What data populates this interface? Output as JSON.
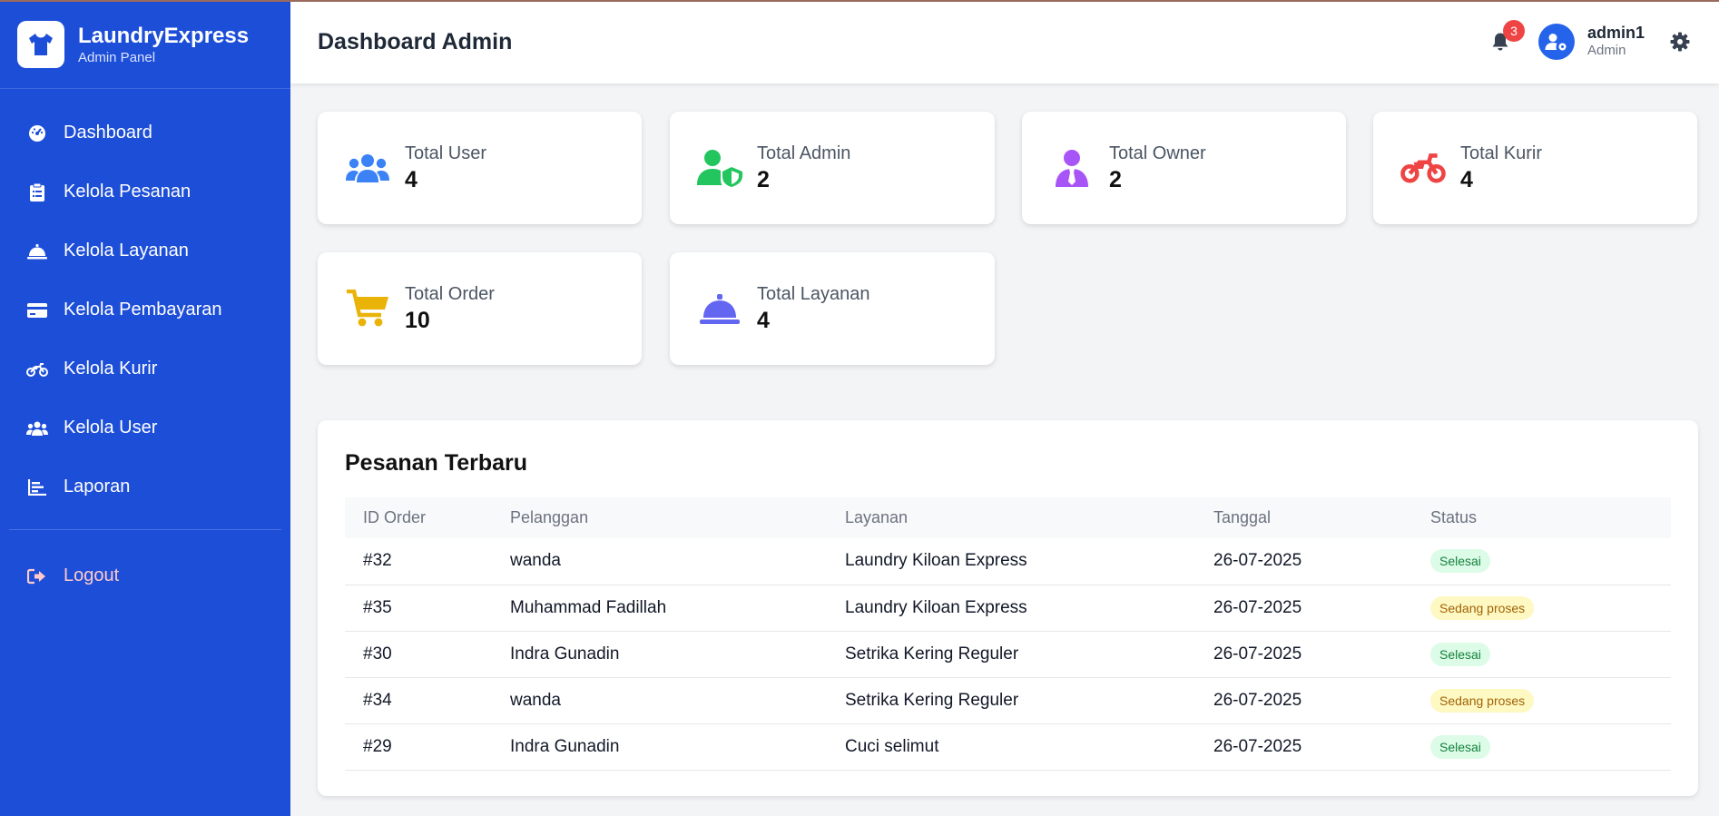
{
  "brand": {
    "name": "LaundryExpress",
    "subtitle": "Admin Panel"
  },
  "sidebar": {
    "items": [
      {
        "label": "Dashboard",
        "icon": "gauge-icon"
      },
      {
        "label": "Kelola Pesanan",
        "icon": "clipboard-icon"
      },
      {
        "label": "Kelola Layanan",
        "icon": "service-bell-icon"
      },
      {
        "label": "Kelola Pembayaran",
        "icon": "credit-card-icon"
      },
      {
        "label": "Kelola Kurir",
        "icon": "motorcycle-icon"
      },
      {
        "label": "Kelola User",
        "icon": "users-icon"
      },
      {
        "label": "Laporan",
        "icon": "chart-icon"
      }
    ],
    "logout": {
      "label": "Logout",
      "icon": "logout-icon"
    }
  },
  "header": {
    "title": "Dashboard Admin",
    "notification_count": "3",
    "user": {
      "name": "admin1",
      "role": "Admin"
    }
  },
  "stats": [
    {
      "label": "Total User",
      "value": "4",
      "icon": "users-icon",
      "color": "#3b82f6"
    },
    {
      "label": "Total Admin",
      "value": "2",
      "icon": "user-shield-icon",
      "color": "#22c55e"
    },
    {
      "label": "Total Owner",
      "value": "2",
      "icon": "user-tie-icon",
      "color": "#a855f7"
    },
    {
      "label": "Total Kurir",
      "value": "4",
      "icon": "motorcycle-icon",
      "color": "#ef4444"
    },
    {
      "label": "Total Order",
      "value": "10",
      "icon": "cart-icon",
      "color": "#eab308"
    },
    {
      "label": "Total Layanan",
      "value": "4",
      "icon": "service-bell-icon",
      "color": "#6366f1"
    }
  ],
  "orders": {
    "title": "Pesanan Terbaru",
    "columns": [
      "ID Order",
      "Pelanggan",
      "Layanan",
      "Tanggal",
      "Status"
    ],
    "rows": [
      {
        "id": "#32",
        "customer": "wanda",
        "service": "Laundry Kiloan Express",
        "date": "26-07-2025",
        "status": "Selesai",
        "status_type": "done"
      },
      {
        "id": "#35",
        "customer": "Muhammad Fadillah",
        "service": "Laundry Kiloan Express",
        "date": "26-07-2025",
        "status": "Sedang proses",
        "status_type": "proc"
      },
      {
        "id": "#30",
        "customer": "Indra Gunadin",
        "service": "Setrika Kering Reguler",
        "date": "26-07-2025",
        "status": "Selesai",
        "status_type": "done"
      },
      {
        "id": "#34",
        "customer": "wanda",
        "service": "Setrika Kering Reguler",
        "date": "26-07-2025",
        "status": "Sedang proses",
        "status_type": "proc"
      },
      {
        "id": "#29",
        "customer": "Indra Gunadin",
        "service": "Cuci selimut",
        "date": "26-07-2025",
        "status": "Selesai",
        "status_type": "done"
      }
    ]
  },
  "colors": {
    "sidebar": "#1d4ed8",
    "accent": "#2563eb",
    "badge_red": "#ef4444",
    "logout": "#fecaca"
  }
}
